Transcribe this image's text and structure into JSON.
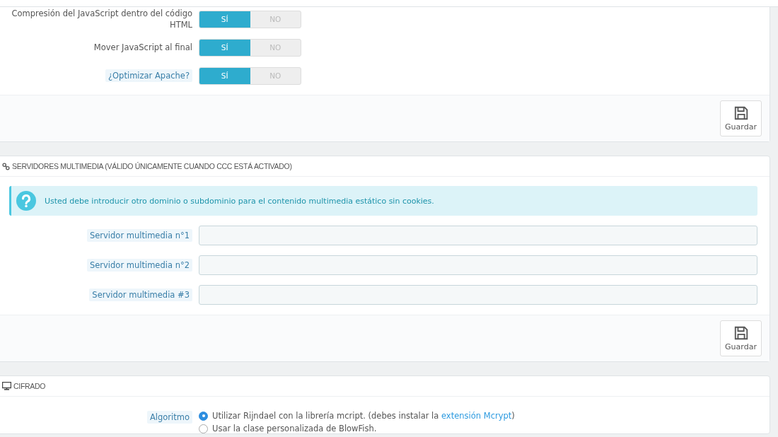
{
  "performance_panel": {
    "switches": [
      {
        "label": "Compresión del JavaScript dentro del código HTML",
        "hint": false,
        "yes": "SÍ",
        "no": "NO",
        "on": true
      },
      {
        "label": "Mover JavaScript al final",
        "hint": false,
        "yes": "SÍ",
        "no": "NO",
        "on": true
      },
      {
        "label": "¿Optimizar Apache?",
        "hint": true,
        "yes": "SÍ",
        "no": "NO",
        "on": true
      }
    ],
    "save_button": "Guardar"
  },
  "media_panel": {
    "title": "SERVIDORES MULTIMEDIA (VÁLIDO ÚNICAMENTE CUANDO CCC ESTÁ ACTIVADO)",
    "alert": "Usted debe introducir otro dominio o subdominio para el contenido multimedia estático sin cookies.",
    "fields": [
      {
        "label": "Servidor multimedia n°1",
        "hint": true
      },
      {
        "label": "Servidor multimedia n°2",
        "hint": true
      },
      {
        "label": "Servidor multimedia #3",
        "hint": true
      }
    ],
    "save_button": "Guardar"
  },
  "cipher_panel": {
    "title": "CIFRADO",
    "label": "Algoritmo",
    "hint": true,
    "options": [
      {
        "text": "Utilizar Rijndael con la librería mcript. (debes instalar la ",
        "link": "extensión Mcrypt",
        "after": ")",
        "selected": true
      },
      {
        "text": "Usar la clase personalizada de BlowFish.",
        "selected": false
      }
    ]
  }
}
